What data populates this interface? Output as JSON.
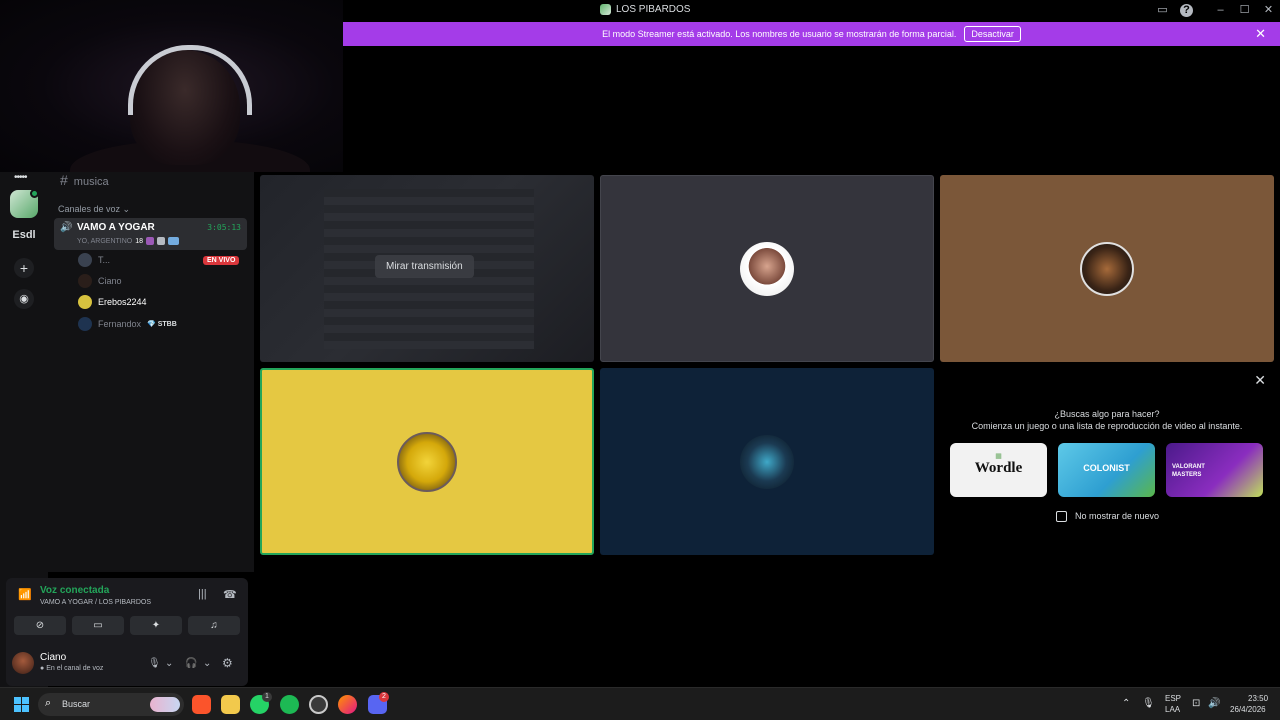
{
  "window": {
    "title": "LOS PIBARDOS"
  },
  "banner": {
    "message": "El modo Streamer está activado. Los nombres de usuario se mostrarán de forma parcial.",
    "button": "Desactivar",
    "close": "✕"
  },
  "rail": {
    "dots": "•••••",
    "server_label": "Esdl"
  },
  "sidebar": {
    "text_channel": "musica",
    "category": "Canales de voz",
    "voice_channel": {
      "name": "VAMO A YOGAR",
      "timer": "3:05:13",
      "status": "YO, ARGENTINO",
      "status_number": "18"
    },
    "users": [
      {
        "name": "T...",
        "badge": "EN VIVO"
      },
      {
        "name": "Ciano"
      },
      {
        "name": "Erebos2244"
      },
      {
        "name": "Fernandox",
        "tag": "STBB"
      }
    ]
  },
  "voice_panel": {
    "status": "Voz conectada",
    "location": "VAMO A YOGAR / LOS PIBARDOS",
    "user_name": "Ciano",
    "user_status": "En el canal de voz"
  },
  "grid": {
    "watch_button": "Mirar transmisión"
  },
  "activity": {
    "question": "¿Buscas algo para hacer?",
    "description": "Comienza un juego o una lista de reproducción de video al instante.",
    "cards": [
      "Wordle",
      "COLONIST",
      "VALORANT MASTERS"
    ],
    "checkbox_label": "No mostrar de nuevo"
  },
  "taskbar": {
    "search_placeholder": "Buscar",
    "lang_top": "ESP",
    "lang_bottom": "LAA",
    "time": "23:50",
    "date": "26/4/2026",
    "whatsapp_badge": "1",
    "discord_badge": "2"
  },
  "colors": {
    "banner": "#a43ce8",
    "accent_green": "#23a55a",
    "live_red": "#da373c",
    "tile_yellow": "#e5c842",
    "tile_brown": "#7b5739",
    "tile_navy": "#0e2238",
    "tile_gray": "#34343c"
  }
}
